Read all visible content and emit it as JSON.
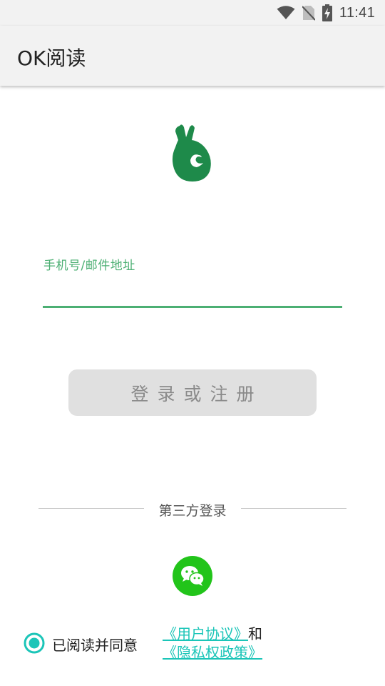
{
  "status_bar": {
    "time": "11:41",
    "icons": [
      "wifi-icon",
      "no-sim-icon",
      "battery-charging-icon"
    ]
  },
  "app_bar": {
    "title": "OK阅读"
  },
  "login_form": {
    "logo": "ok-hand-logo",
    "input_label": "手机号/邮件地址",
    "input_value": "",
    "submit_label": "登录或注册"
  },
  "third_party": {
    "divider_label": "第三方登录",
    "providers": [
      {
        "name": "wechat",
        "icon": "wechat-icon"
      }
    ]
  },
  "agreement": {
    "checked": true,
    "prefix": "已阅读并同意",
    "user_agreement": "《用户协议》",
    "conjunction": "和",
    "privacy_policy": "《隐私权政策》"
  },
  "colors": {
    "accent_green": "#4caf73",
    "logo_green": "#1e8a4a",
    "wechat_green": "#22c41a",
    "link_teal": "#1bc5b8",
    "button_disabled": "#e0e0e0"
  }
}
